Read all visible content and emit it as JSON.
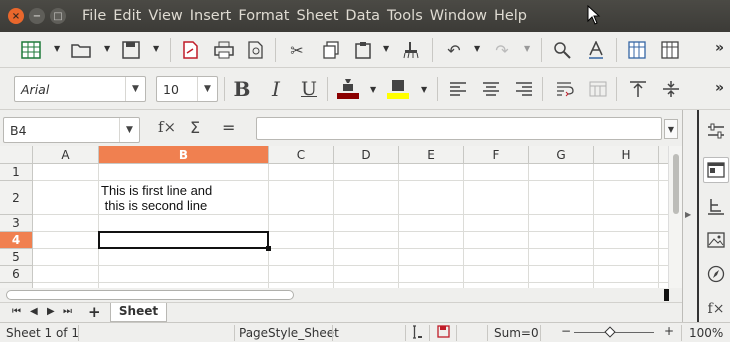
{
  "window_controls": {
    "close": "×",
    "minimize": "−",
    "maximize": "□"
  },
  "menu": [
    "File",
    "Edit",
    "View",
    "Insert",
    "Format",
    "Sheet",
    "Data",
    "Tools",
    "Window",
    "Help"
  ],
  "toolbar_more": "»",
  "formatting": {
    "font_name": "Arial",
    "font_size": "10",
    "bold": "B",
    "italic": "I",
    "underline": "U",
    "font_color": "#8b0000",
    "highlight_color": "#ffff00"
  },
  "formula_bar": {
    "name_box": "B4",
    "function_wizard": "f×",
    "sum": "Σ",
    "equals": "=",
    "input_value": ""
  },
  "columns": [
    "A",
    "B",
    "C",
    "D",
    "E",
    "F",
    "G",
    "H"
  ],
  "selected_column": "B",
  "rows": [
    "1",
    "2",
    "3",
    "4",
    "5",
    "6"
  ],
  "selected_row": "4",
  "cells": {
    "B2": "This is first line and\n this is second line"
  },
  "sheet_tabs": {
    "nav_first": "⏮",
    "nav_prev": "◀",
    "nav_next": "▶",
    "nav_last": "⏭",
    "add": "+",
    "active": "Sheet"
  },
  "status_bar": {
    "sheet_info": "Sheet 1 of 1",
    "page_style": "PageStyle_Sheet",
    "sum": "Sum=0",
    "zoom_minus": "−",
    "zoom_plus": "+",
    "zoom": "100%"
  },
  "sidebar_more": "f×",
  "colors": {
    "selection_accent": "#f08050",
    "menubar": "#3c3b37",
    "close_button": "#e9672c"
  }
}
